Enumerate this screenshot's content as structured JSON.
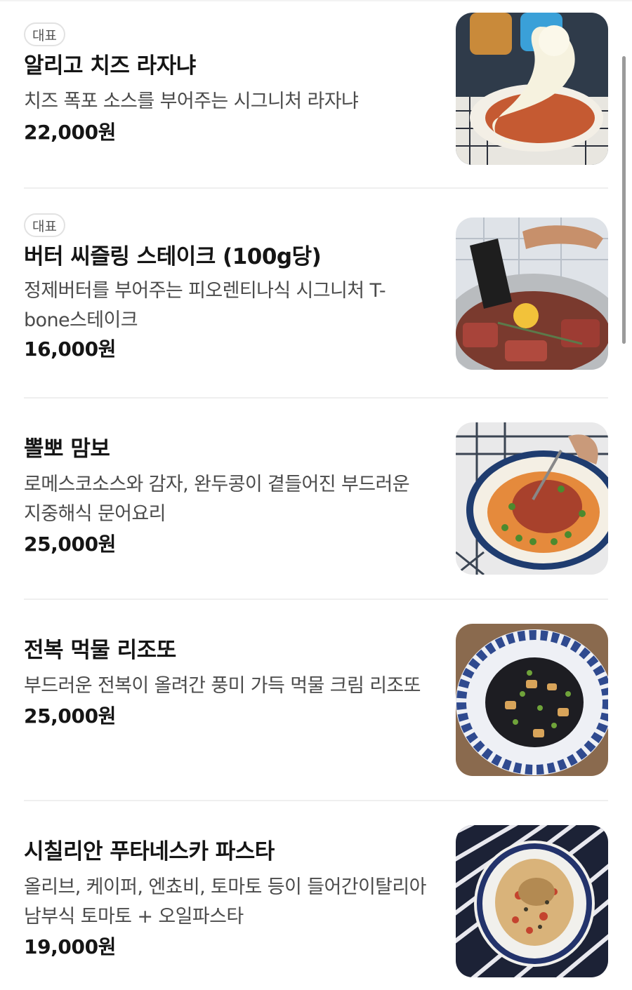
{
  "menu": {
    "items": [
      {
        "badge": "대표",
        "name": "알리고 치즈 라자냐",
        "description": "치즈 폭포 소스를 부어주는 시그니처 라자냐",
        "price": "22,000원",
        "photo": "cheese-lasagna-photo"
      },
      {
        "badge": "대표",
        "name": "버터 씨즐링 스테이크 (100g당)",
        "description": "정제버터를 부어주는 피오렌티나식 시그니처 T-bone스테이크",
        "price": "16,000원",
        "photo": "butter-steak-photo"
      },
      {
        "badge": "",
        "name": "뽈뽀 맘보",
        "description": "로메스코소스와 감자, 완두콩이 곁들어진 부드러운 지중해식 문어요리",
        "price": "25,000원",
        "photo": "octopus-dish-photo"
      },
      {
        "badge": "",
        "name": "전복 먹물 리조또",
        "description": "부드러운 전복이 올려간 풍미 가득 먹물 크림 리조또",
        "price": "25,000원",
        "photo": "squid-ink-risotto-photo"
      },
      {
        "badge": "",
        "name": "시칠리안 푸타네스카 파스타",
        "description": "올리브, 케이퍼, 엔쵸비, 토마토 등이 들어간이탈리아 남부식 토마토 + 오일파스타",
        "price": "19,000원",
        "photo": "puttanesca-pasta-photo"
      }
    ]
  }
}
